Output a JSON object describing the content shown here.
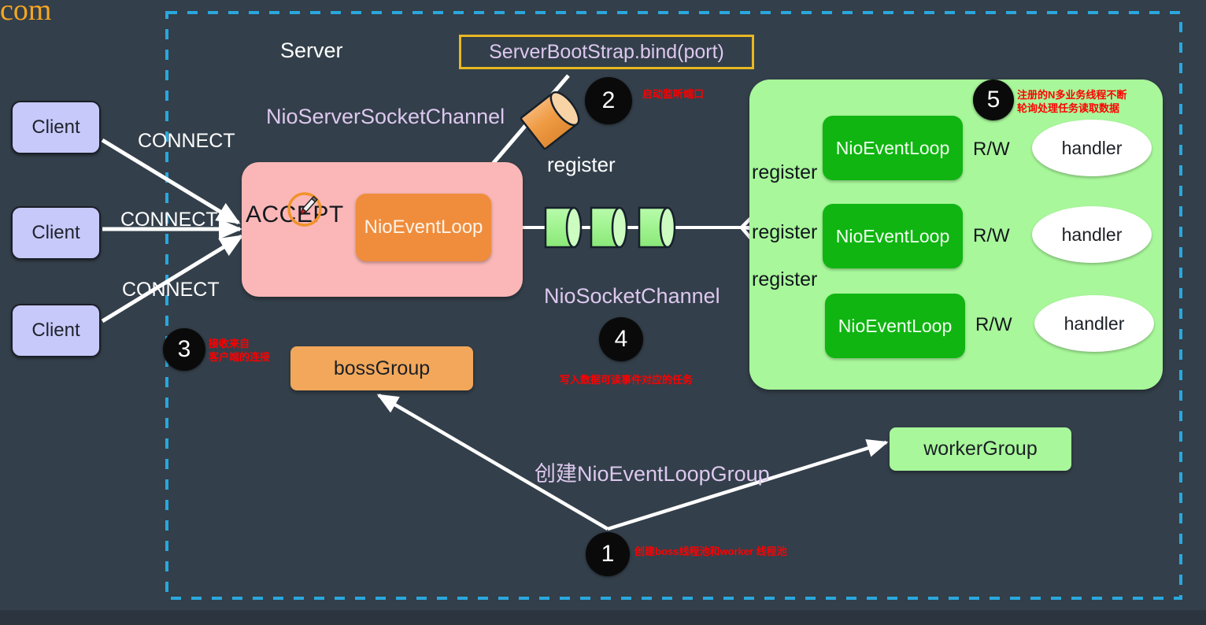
{
  "watermark": "com",
  "diagram": {
    "server_label": "Server",
    "nio_server_socket_channel": "NioServerSocketChannel",
    "bootstrap_bind": "ServerBootStrap.bind(port)",
    "register_center": "register",
    "nio_socket_channel": "NioSocketChannel",
    "create_group": "创建NioEventLoopGroup",
    "accept_label": "ACCEPT",
    "boss_event_loop": "NioEventLoop",
    "boss_group": "bossGroup",
    "worker_group": "workerGroup"
  },
  "clients": [
    {
      "label": "Client",
      "edge_label": "CONNECT"
    },
    {
      "label": "Client",
      "edge_label": "CONNECT"
    },
    {
      "label": "Client",
      "edge_label": "CONNECT"
    }
  ],
  "worker_rows": [
    {
      "register_label": "register",
      "event_loop": "NioEventLoop",
      "rw": "R/W",
      "handler": "handler"
    },
    {
      "register_label": "register",
      "event_loop": "NioEventLoop",
      "rw": "R/W",
      "handler": "handler"
    },
    {
      "register_label": "register",
      "event_loop": "NioEventLoop",
      "rw": "R/W",
      "handler": "handler"
    }
  ],
  "steps": [
    {
      "number": "1",
      "note": "创建boss线程池和worker 线程池"
    },
    {
      "number": "2",
      "note": "启动监听端口"
    },
    {
      "number": "3",
      "note": "接收来自\n客户端的连接"
    },
    {
      "number": "4",
      "note": "写入数据可读事件对应的任务"
    },
    {
      "number": "5",
      "note": "注册的N多业务线程不断\n轮询处理任务读取数据"
    }
  ],
  "colors": {
    "background": "#333f4a",
    "dashed_border": "#29a8dd",
    "client_box": "#c7c9fb",
    "accept_panel": "#fbb7b7",
    "boss_event_loop": "#ef8d3c",
    "worker_panel": "#a8f79a",
    "worker_event_loop": "#10b512",
    "handler": "#ffffff",
    "boss_group": "#f2a75a",
    "worker_group": "#a8f79a",
    "bootstrap_border": "#e8b822",
    "purple_text": "#ddc8ef",
    "note_text": "#ff0000",
    "watermark": "#f5a623",
    "channel_cylinder": "#a8f79a",
    "register_cylinder": "#ef9b44"
  }
}
